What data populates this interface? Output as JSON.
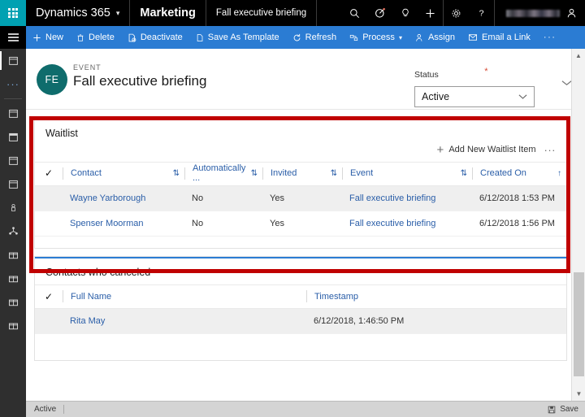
{
  "topnav": {
    "waffle_icon": "waffle-grid-icon",
    "brand": "Dynamics 365",
    "brand_chevron": "chevron-down-icon",
    "app_name": "Marketing",
    "record_name": "Fall executive briefing",
    "icons": [
      {
        "name": "search-icon",
        "glyph": "search"
      },
      {
        "name": "filter-target-icon",
        "glyph": "target"
      },
      {
        "name": "lightbulb-icon",
        "glyph": "bulb"
      },
      {
        "name": "quick-create-icon",
        "glyph": "plus"
      },
      {
        "name": "settings-gear-icon",
        "glyph": "gear"
      },
      {
        "name": "help-icon",
        "glyph": "question"
      }
    ],
    "user": {
      "name_redacted": true,
      "avatar_icon": "user-avatar-icon"
    }
  },
  "commandbar": {
    "menu_icon": "hamburger-menu-icon",
    "commands": [
      {
        "label": "New",
        "icon": "plus-icon"
      },
      {
        "label": "Delete",
        "icon": "trash-icon"
      },
      {
        "label": "Deactivate",
        "icon": "deactivate-icon"
      },
      {
        "label": "Save As Template",
        "icon": "document-icon"
      },
      {
        "label": "Refresh",
        "icon": "refresh-icon"
      },
      {
        "label": "Process",
        "icon": "process-icon",
        "chevron": "chevron-down-icon"
      },
      {
        "label": "Assign",
        "icon": "person-assign-icon"
      },
      {
        "label": "Email a Link",
        "icon": "email-link-icon"
      },
      {
        "label": "···",
        "icon": "overflow-ellipsis-icon"
      }
    ]
  },
  "sidebar": {
    "items": [
      {
        "name": "sidebar-item-recent-calendar",
        "icon": "calendar-icon",
        "selected": true
      },
      {
        "name": "sidebar-item-more",
        "icon": "ellipsis-icon"
      },
      {
        "name": "sidebar-item-events",
        "icon": "calendar-icon"
      },
      {
        "name": "sidebar-item-event-series",
        "icon": "calendar-filled-icon"
      },
      {
        "name": "sidebar-item-sessions",
        "icon": "calendar-icon"
      },
      {
        "name": "sidebar-item-session-tracks",
        "icon": "calendar-icon"
      },
      {
        "name": "sidebar-item-speakers",
        "icon": "person-icon"
      },
      {
        "name": "sidebar-item-sponsorships",
        "icon": "network-icon"
      },
      {
        "name": "sidebar-item-venues",
        "icon": "building-icon"
      },
      {
        "name": "sidebar-item-buildings",
        "icon": "building-icon"
      },
      {
        "name": "sidebar-item-rooms",
        "icon": "building-icon"
      },
      {
        "name": "sidebar-item-layouts",
        "icon": "building-icon"
      }
    ]
  },
  "record": {
    "avatar_initials": "FE",
    "kicker": "EVENT",
    "title": "Fall executive briefing",
    "status_label": "Status",
    "required_marker": "*",
    "status_value": "Active",
    "status_chevron": "chevron-down-icon",
    "header_expand_icon": "chevron-down-icon"
  },
  "waitlist": {
    "title": "Waitlist",
    "add_label": "Add New Waitlist Item",
    "add_icon": "plus-icon",
    "overflow_icon": "ellipsis-icon",
    "select_all_icon": "checkmark-icon",
    "columns": [
      {
        "label": "Contact",
        "sort": "both"
      },
      {
        "label": "Automatically ...",
        "sort": "both"
      },
      {
        "label": "Invited",
        "sort": "both"
      },
      {
        "label": "Event",
        "sort": "both"
      },
      {
        "label": "Created On",
        "sort": "asc"
      }
    ],
    "rows": [
      {
        "contact": "Wayne Yarborough",
        "automatically": "No",
        "invited": "Yes",
        "event": "Fall executive briefing",
        "created_on": "6/12/2018 1:53 PM"
      },
      {
        "contact": "Spenser Moorman",
        "automatically": "No",
        "invited": "Yes",
        "event": "Fall executive briefing",
        "created_on": "6/12/2018 1:56 PM"
      }
    ]
  },
  "canceled": {
    "title": "Contacts who canceled",
    "select_all_icon": "checkmark-icon",
    "columns": [
      {
        "label": "Full Name"
      },
      {
        "label": "Timestamp"
      }
    ],
    "rows": [
      {
        "full_name": "Rita May",
        "timestamp": "6/12/2018, 1:46:50 PM"
      }
    ]
  },
  "footer": {
    "status": "Active",
    "save_label": "Save",
    "save_icon": "save-disk-icon"
  },
  "scrollbar": {
    "up_icon": "scroll-up-icon",
    "down_icon": "scroll-down-icon"
  },
  "colors": {
    "brand_teal": "#00a1b2",
    "command_blue": "#2b7cd3",
    "link_blue": "#2a5ea8",
    "annotation_red": "#c00000",
    "avatar_teal": "#0f6c6c",
    "required_red": "#d64b35"
  }
}
